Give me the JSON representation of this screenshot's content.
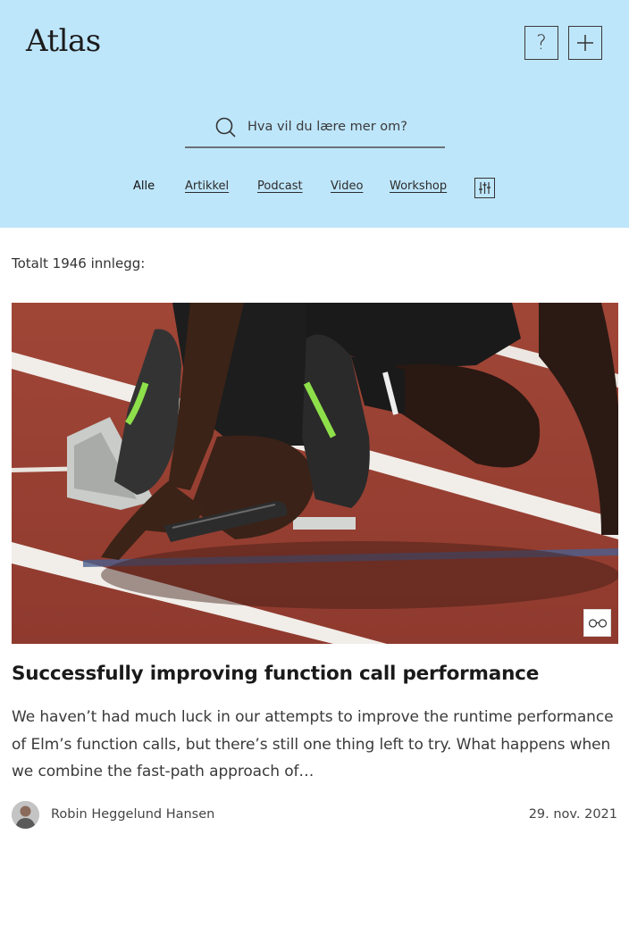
{
  "app": {
    "logo": "Atlas"
  },
  "header": {
    "help_label": "?",
    "search": {
      "placeholder": "Hva vil du lære mer om?",
      "value": ""
    },
    "filters": [
      {
        "label": "Alle",
        "active": true
      },
      {
        "label": "Artikkel",
        "active": false
      },
      {
        "label": "Podcast",
        "active": false
      },
      {
        "label": "Video",
        "active": false
      },
      {
        "label": "Workshop",
        "active": false
      }
    ]
  },
  "main": {
    "total_label": "Totalt 1946 innlegg:",
    "card": {
      "title": "Successfully improving function call performance",
      "excerpt": "We haven’t had much luck in our attempts to improve the runtime performance of Elm’s function calls, but there’s still one thing left to try. What happens when we combine the fast-path approach of…",
      "author": "Robin Heggelund Hansen",
      "date": "29. nov. 2021",
      "badge_icon": "glasses-icon"
    }
  },
  "colors": {
    "header_bg": "#bee6fb",
    "track": "#9a3f32"
  }
}
